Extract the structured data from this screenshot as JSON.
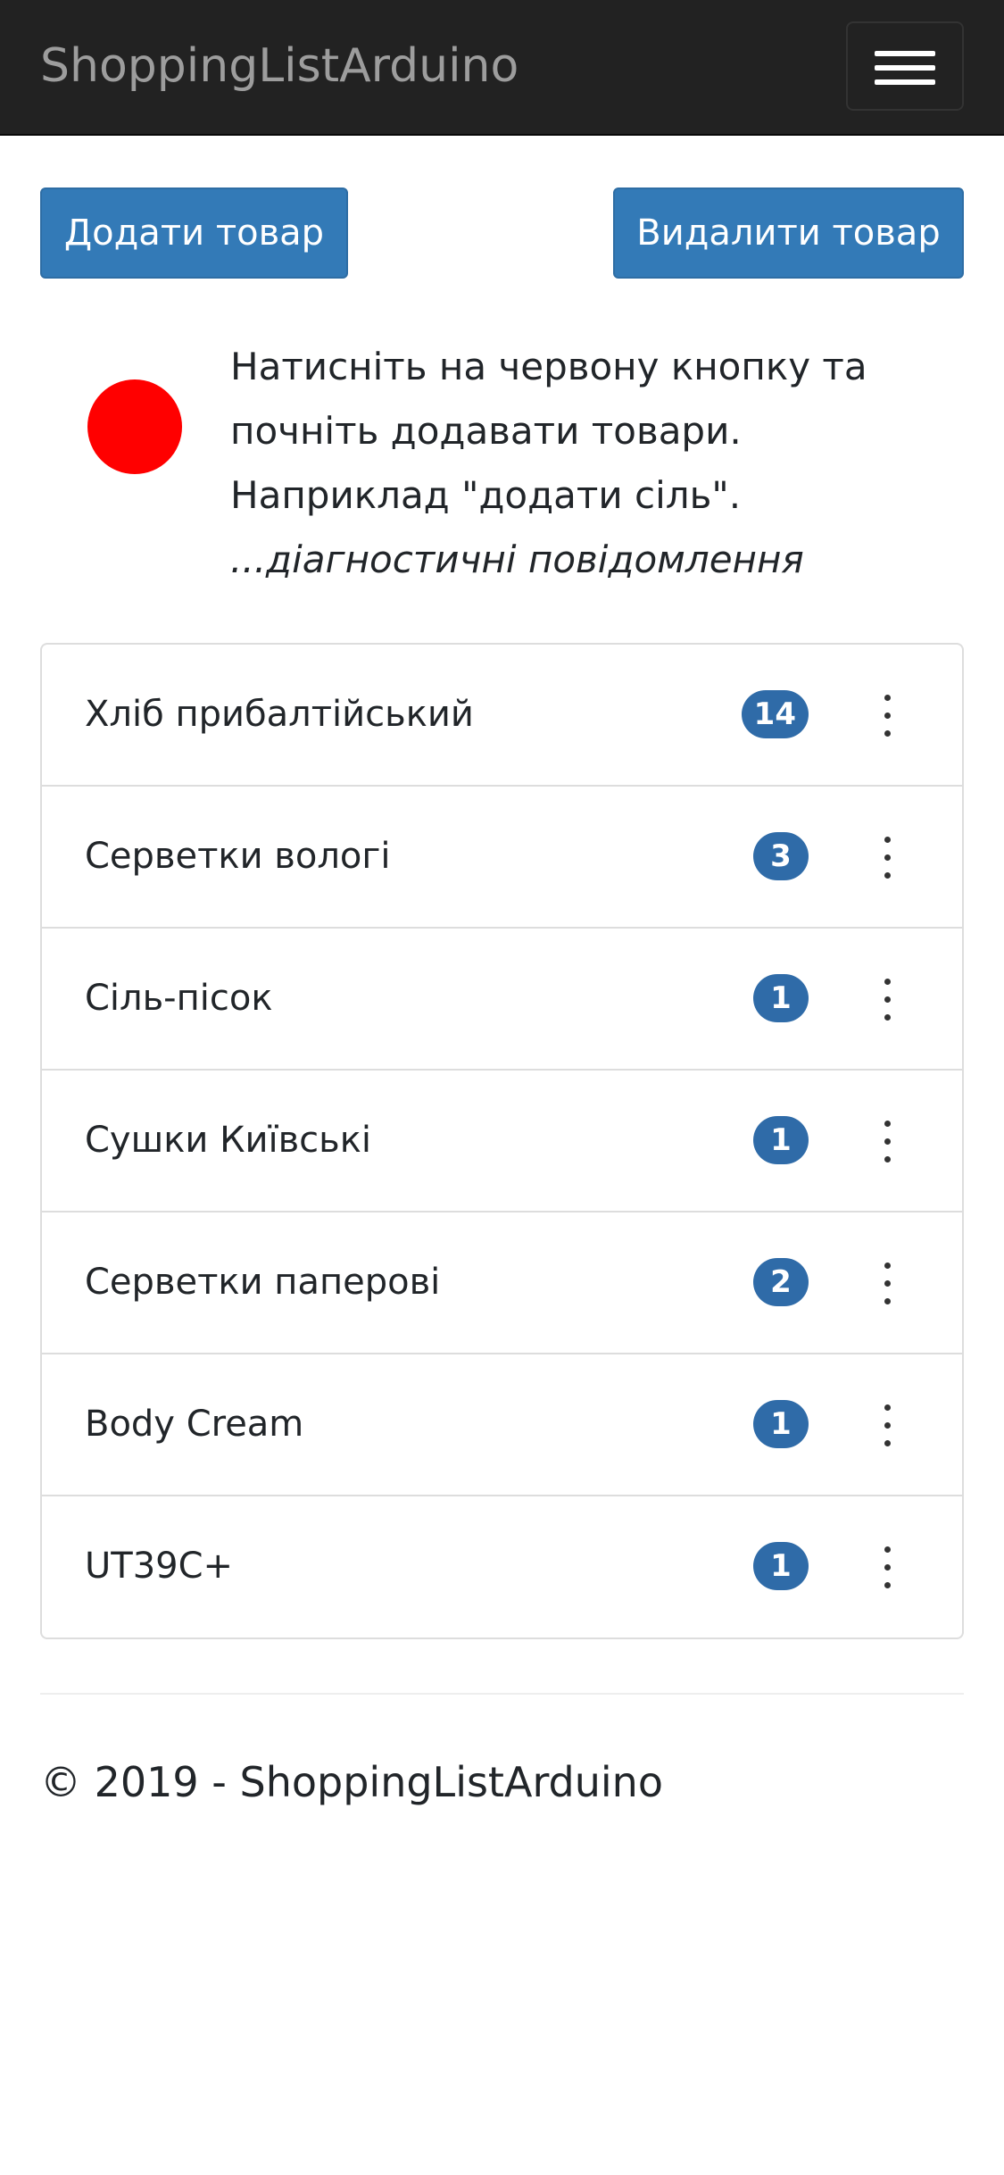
{
  "navbar": {
    "brand": "ShoppingListArduino",
    "menu_icon": "hamburger-menu-icon"
  },
  "actions": {
    "add_label": "Додати товар",
    "delete_label": "Видалити товар"
  },
  "status": {
    "indicator_color": "#ff0000",
    "hint_line1": "Натисніть на червону кнопку та",
    "hint_line2": "почніть додавати товари.",
    "hint_line3": "Наприклад \"додати сіль\".",
    "diagnostics": "...діагностичні повідомлення"
  },
  "items": [
    {
      "name": "Хліб прибалтійський",
      "count": "14"
    },
    {
      "name": "Серветки вологі",
      "count": "3"
    },
    {
      "name": "Сіль-пісок",
      "count": "1"
    },
    {
      "name": "Сушки Київські",
      "count": "1"
    },
    {
      "name": "Серветки паперові",
      "count": "2"
    },
    {
      "name": "Body Cream",
      "count": "1"
    },
    {
      "name": "UT39C+",
      "count": "1"
    }
  ],
  "footer": {
    "text": "© 2019 - ShoppingListArduino"
  },
  "colors": {
    "navbar_bg": "#222222",
    "brand_text": "#9d9d9d",
    "primary_button": "#337ab7",
    "badge": "#2f6ba8"
  }
}
